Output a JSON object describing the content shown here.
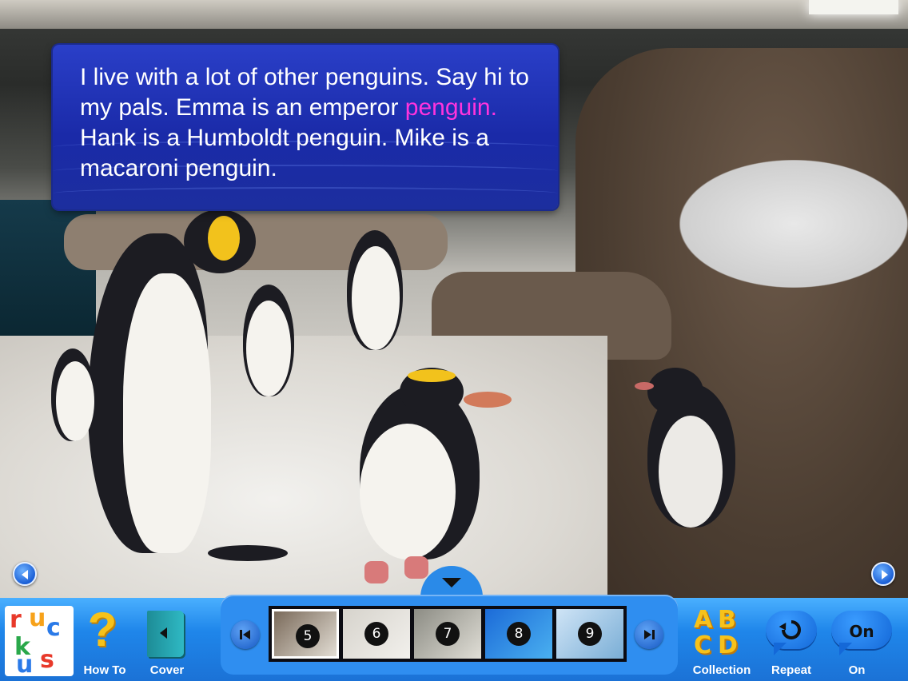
{
  "story": {
    "line_segments": [
      {
        "text": "I live with a lot of other penguins. Say hi to my pals. Emma is an emperor ",
        "highlight": false
      },
      {
        "text": "penguin.",
        "highlight": true
      },
      {
        "text": " Hank is a Humboldt penguin. Mike is a macaroni penguin.",
        "highlight": false
      }
    ],
    "highlight_color": "#ff33dd"
  },
  "nav": {
    "prev_icon": "triangle-left-icon",
    "next_icon": "triangle-right-icon",
    "drawer_icon": "triangle-down-icon"
  },
  "toolbar": {
    "logo_letters": [
      "r",
      "u",
      "c",
      "k",
      "u",
      "s"
    ],
    "howto_label": "How To",
    "howto_glyph": "?",
    "cover_label": "Cover",
    "thumbnails": [
      {
        "num": "5",
        "selected": true
      },
      {
        "num": "6",
        "selected": false
      },
      {
        "num": "7",
        "selected": false
      },
      {
        "num": "8",
        "selected": false
      },
      {
        "num": "9",
        "selected": false
      }
    ],
    "collection_label": "Collection",
    "collection_letters": [
      "A",
      "B",
      "C",
      "D"
    ],
    "repeat_label": "Repeat",
    "on_label": "On",
    "on_button_text": "On"
  },
  "colors": {
    "toolbar_blue": "#1f86ea",
    "textbox_blue": "#1a2aa8",
    "accent_yellow": "#f7c21a"
  }
}
